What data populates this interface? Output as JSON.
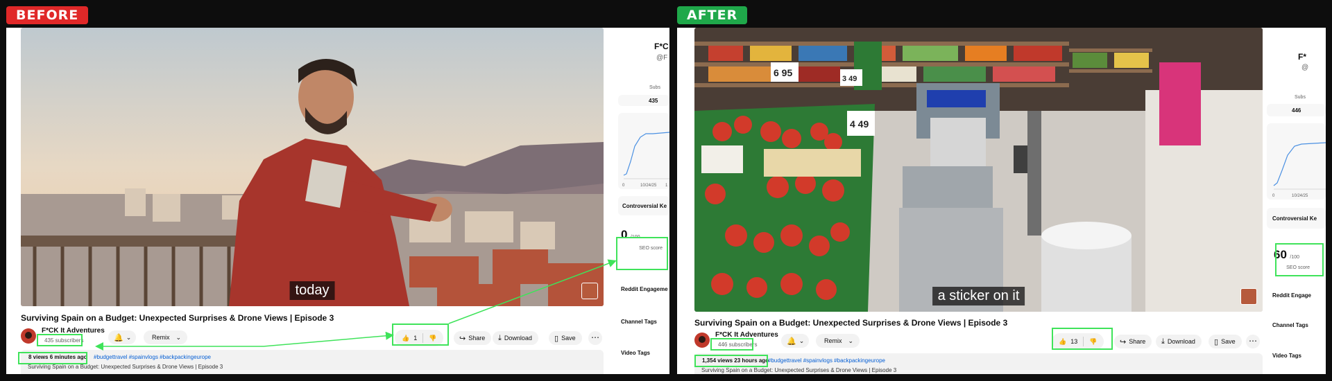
{
  "labels": {
    "before": "BEFORE",
    "after": "AFTER"
  },
  "colors": {
    "highlight": "#3fe35a",
    "before_tag": "#e02828",
    "after_tag": "#1fa84a",
    "link": "#065fd4"
  },
  "before": {
    "caption": "today",
    "title": "Surviving Spain on a Budget: Unexpected Surprises & Drone Views | Episode 3",
    "channel": "F*CK It Adventures",
    "subscribers": "435 subscribers",
    "remix": "Remix",
    "likes": "1",
    "share": "Share",
    "download": "Download",
    "save": "Save",
    "meta": "8 views  6 minutes ago",
    "hashtags": "#budgettravel #spainvlogs #backpackingeurope",
    "desc": "Surviving Spain on a Budget: Unexpected Surprises & Drone Views | Episode 3",
    "side": {
      "channel": "F*C",
      "handle": "@F",
      "subs_label": "Subs",
      "subs_value": "435",
      "chart_tick_0": "0",
      "chart_tick_date": "10/24/25",
      "chart_tick_end": "1",
      "controversial": "Controversial Ke",
      "seo_score": "0",
      "seo_unit": "/100",
      "seo_label": "SEO score",
      "reddit": "Reddit Engageme",
      "channel_tags": "Channel Tags",
      "video_tags": "Video Tags"
    }
  },
  "after": {
    "caption": "a sticker on it",
    "title": "Surviving Spain on a Budget: Unexpected Surprises & Drone Views | Episode 3",
    "channel": "F*CK It Adventures",
    "subscribers": "446 subscribers",
    "remix": "Remix",
    "likes": "13",
    "share": "Share",
    "download": "Download",
    "save": "Save",
    "meta": "1,354 views  23 hours ago",
    "hashtags": "#budgettravel #spainvlogs #backpackingeurope",
    "desc": "Surviving Spain on a Budget: Unexpected Surprises & Drone Views | Episode 3",
    "price_sign_1": "6 95",
    "price_sign_2": "4 49",
    "price_sign_3": "3 49",
    "side": {
      "channel": "F*",
      "handle": "@",
      "subs_label": "Subs",
      "subs_value": "446",
      "chart_tick_0": "0",
      "chart_tick_date": "10/24/25",
      "controversial": "Controversial Ke",
      "seo_score": "60",
      "seo_unit": "/100",
      "seo_label": "SEO score",
      "reddit": "Reddit Engage",
      "channel_tags": "Channel Tags",
      "video_tags": "Video Tags"
    }
  }
}
